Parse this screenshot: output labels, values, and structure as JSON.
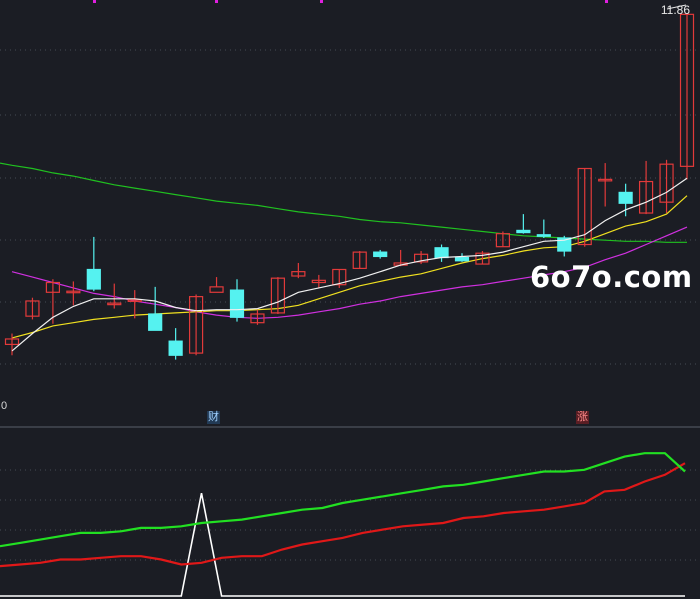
{
  "price_high_label": "11.86",
  "axis_zero_label": "0",
  "markers": {
    "cai": "财",
    "zhang": "涨"
  },
  "watermark": "6o7o.com",
  "colors": {
    "background": "#1b1d24",
    "up_candle": "#e23a3a",
    "down_candle": "#55f2f0",
    "ma_white": "#f0f0f0",
    "ma_yellow": "#f0e020",
    "ma_magenta": "#d030e0",
    "ma_green": "#20c020",
    "indicator_green": "#22e022",
    "indicator_red": "#e01818",
    "indicator_white": "#ffffff",
    "grid": "#454a55"
  },
  "chart_data": [
    {
      "type": "candlestick",
      "ylim": [
        8.4,
        11.9
      ],
      "candles": [
        {
          "o": 8.82,
          "h": 8.92,
          "l": 8.72,
          "c": 8.87
        },
        {
          "o": 9.08,
          "h": 9.25,
          "l": 9.05,
          "c": 9.22
        },
        {
          "o": 9.3,
          "h": 9.42,
          "l": 9.01,
          "c": 9.39
        },
        {
          "o": 9.31,
          "h": 9.4,
          "l": 9.18,
          "c": 9.31
        },
        {
          "o": 9.51,
          "h": 9.81,
          "l": 9.31,
          "c": 9.33
        },
        {
          "o": 9.2,
          "h": 9.38,
          "l": 9.15,
          "c": 9.2
        },
        {
          "o": 9.22,
          "h": 9.32,
          "l": 9.06,
          "c": 9.23
        },
        {
          "o": 9.1,
          "h": 9.35,
          "l": 9.08,
          "c": 8.95
        },
        {
          "o": 8.85,
          "h": 8.97,
          "l": 8.68,
          "c": 8.72
        },
        {
          "o": 8.74,
          "h": 9.28,
          "l": 8.72,
          "c": 9.26
        },
        {
          "o": 9.3,
          "h": 9.44,
          "l": 9.35,
          "c": 9.35
        },
        {
          "o": 9.32,
          "h": 9.42,
          "l": 9.03,
          "c": 9.07
        },
        {
          "o": 9.02,
          "h": 9.14,
          "l": 9.0,
          "c": 9.1
        },
        {
          "o": 9.11,
          "h": 9.44,
          "l": 9.1,
          "c": 9.43
        },
        {
          "o": 9.45,
          "h": 9.57,
          "l": 9.43,
          "c": 9.49
        },
        {
          "o": 9.39,
          "h": 9.46,
          "l": 9.34,
          "c": 9.41
        },
        {
          "o": 9.37,
          "h": 9.51,
          "l": 9.34,
          "c": 9.51
        },
        {
          "o": 9.52,
          "h": 9.68,
          "l": 9.52,
          "c": 9.67
        },
        {
          "o": 9.67,
          "h": 9.69,
          "l": 9.61,
          "c": 9.63
        },
        {
          "o": 9.55,
          "h": 9.69,
          "l": 9.54,
          "c": 9.57
        },
        {
          "o": 9.58,
          "h": 9.68,
          "l": 9.56,
          "c": 9.65
        },
        {
          "o": 9.71,
          "h": 9.74,
          "l": 9.58,
          "c": 9.62
        },
        {
          "o": 9.62,
          "h": 9.66,
          "l": 9.58,
          "c": 9.59
        },
        {
          "o": 9.56,
          "h": 9.68,
          "l": 9.56,
          "c": 9.66
        },
        {
          "o": 9.72,
          "h": 9.86,
          "l": 9.72,
          "c": 9.84
        },
        {
          "o": 9.87,
          "h": 10.02,
          "l": 9.84,
          "c": 9.85
        },
        {
          "o": 9.83,
          "h": 9.97,
          "l": 9.8,
          "c": 9.82
        },
        {
          "o": 9.8,
          "h": 9.82,
          "l": 9.63,
          "c": 9.68
        },
        {
          "o": 9.74,
          "h": 10.44,
          "l": 9.72,
          "c": 10.44
        },
        {
          "o": 10.34,
          "h": 10.49,
          "l": 10.09,
          "c": 10.34
        },
        {
          "o": 10.22,
          "h": 10.3,
          "l": 10.0,
          "c": 10.12
        },
        {
          "o": 10.03,
          "h": 10.51,
          "l": 10.02,
          "c": 10.32
        },
        {
          "o": 10.13,
          "h": 10.52,
          "l": 10.03,
          "c": 10.48
        },
        {
          "o": 10.46,
          "h": 11.86,
          "l": 10.34,
          "c": 11.86
        }
      ],
      "ma_white": [
        8.76,
        8.92,
        9.07,
        9.17,
        9.24,
        9.24,
        9.24,
        9.22,
        9.16,
        9.13,
        9.14,
        9.14,
        9.15,
        9.21,
        9.3,
        9.34,
        9.38,
        9.43,
        9.49,
        9.55,
        9.59,
        9.62,
        9.63,
        9.64,
        9.67,
        9.72,
        9.77,
        9.78,
        9.83,
        9.96,
        10.06,
        10.13,
        10.22,
        10.35
      ],
      "ma_yellow": [
        8.88,
        8.93,
        8.99,
        9.02,
        9.05,
        9.07,
        9.09,
        9.1,
        9.11,
        9.12,
        9.13,
        9.13,
        9.14,
        9.15,
        9.18,
        9.24,
        9.3,
        9.36,
        9.4,
        9.44,
        9.47,
        9.52,
        9.57,
        9.61,
        9.64,
        9.68,
        9.71,
        9.72,
        9.77,
        9.84,
        9.91,
        9.95,
        10.02,
        10.19
      ],
      "ma_magenta": [
        9.49,
        9.44,
        9.39,
        9.34,
        9.29,
        9.26,
        9.22,
        9.19,
        9.16,
        9.12,
        9.09,
        9.07,
        9.06,
        9.07,
        9.09,
        9.12,
        9.15,
        9.19,
        9.22,
        9.26,
        9.29,
        9.32,
        9.35,
        9.37,
        9.4,
        9.43,
        9.46,
        9.49,
        9.53,
        9.6,
        9.66,
        9.74,
        9.82,
        9.9
      ],
      "ma_green": [
        10.47,
        10.44,
        10.4,
        10.37,
        10.33,
        10.29,
        10.26,
        10.23,
        10.2,
        10.17,
        10.14,
        10.12,
        10.1,
        10.07,
        10.04,
        10.02,
        10.0,
        9.97,
        9.95,
        9.94,
        9.92,
        9.9,
        9.88,
        9.86,
        9.84,
        9.82,
        9.81,
        9.8,
        9.79,
        9.78,
        9.77,
        9.77,
        9.76,
        9.76
      ]
    },
    {
      "type": "line",
      "ylim": [
        0,
        100
      ],
      "series_green": [
        30,
        32,
        34,
        36,
        38,
        38,
        39,
        41,
        41,
        42,
        44,
        45,
        46,
        48,
        50,
        52,
        53,
        56,
        58,
        60,
        62,
        64,
        66,
        67,
        69,
        71,
        73,
        75,
        75,
        76,
        80,
        84,
        86,
        86,
        75
      ],
      "series_red": [
        18,
        19,
        20,
        22,
        22,
        23,
        24,
        24,
        22,
        19,
        20,
        23,
        24,
        24,
        28,
        31,
        33,
        35,
        38,
        40,
        42,
        43,
        44,
        47,
        48,
        50,
        51,
        52,
        54,
        56,
        63,
        64,
        69,
        73,
        80
      ],
      "series_white": [
        0,
        0,
        0,
        0,
        0,
        0,
        0,
        0,
        0,
        0,
        62,
        0,
        0,
        0,
        0,
        0,
        0,
        0,
        0,
        0,
        0,
        0,
        0,
        0,
        0,
        0,
        0,
        0,
        0,
        0,
        0,
        0,
        0,
        0,
        0
      ]
    }
  ]
}
